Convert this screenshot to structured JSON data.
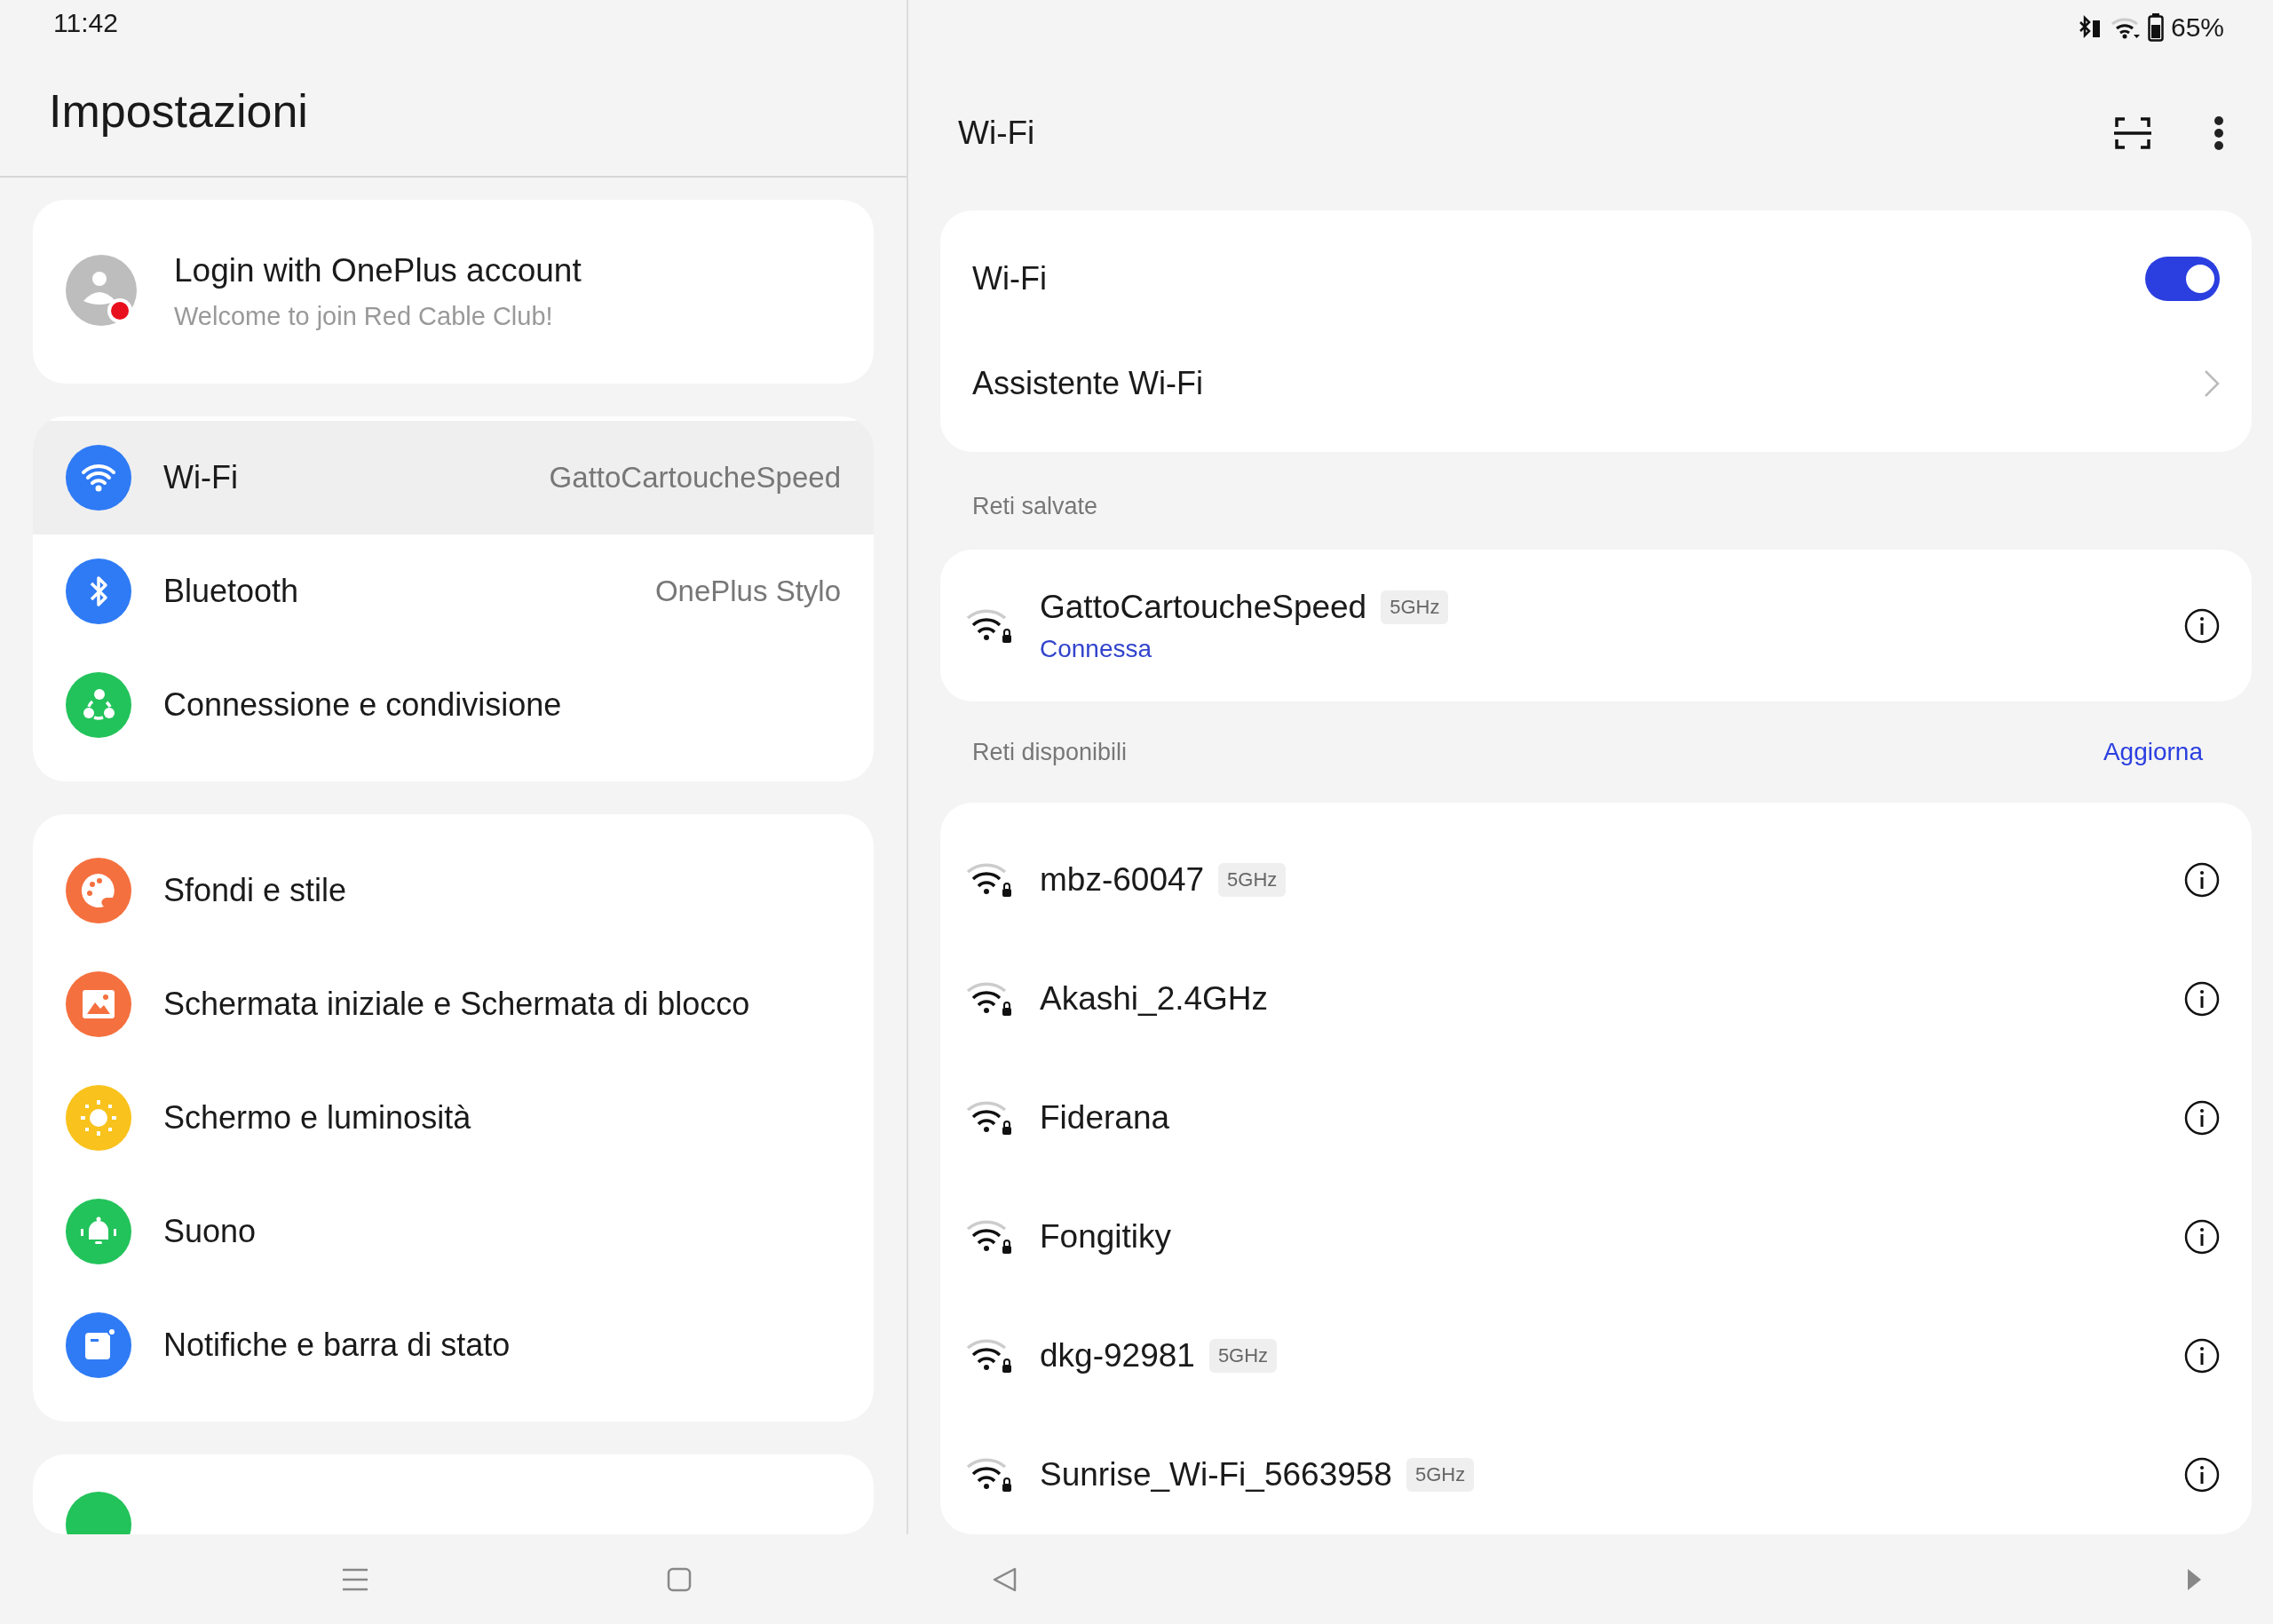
{
  "status_bar": {
    "time": "11:42",
    "battery": "65%"
  },
  "settings": {
    "title": "Impostazioni",
    "account": {
      "title": "Login with OnePlus account",
      "subtitle": "Welcome to join Red Cable Club!"
    },
    "groups": [
      {
        "items": [
          {
            "kind": "wifi",
            "label": "Wi-Fi",
            "value": "GattoCartoucheSpeed",
            "selected": true
          },
          {
            "kind": "bluetooth",
            "label": "Bluetooth",
            "value": "OnePlus Stylo",
            "selected": false
          },
          {
            "kind": "share",
            "label": "Connessione e condivisione",
            "selected": false
          }
        ]
      },
      {
        "items": [
          {
            "kind": "palette",
            "label": "Sfondi e stile",
            "selected": false
          },
          {
            "kind": "image",
            "label": "Schermata iniziale e Schermata di blocco",
            "selected": false
          },
          {
            "kind": "sun",
            "label": "Schermo e luminosità",
            "selected": false
          },
          {
            "kind": "bell",
            "label": "Suono",
            "selected": false
          },
          {
            "kind": "notification",
            "label": "Notifiche e barra di stato",
            "selected": false
          }
        ]
      }
    ]
  },
  "wifi": {
    "title": "Wi-Fi",
    "toggle": {
      "label": "Wi-Fi",
      "on": true
    },
    "assistant": {
      "label": "Assistente Wi-Fi"
    },
    "saved": {
      "heading": "Reti salvate",
      "networks": [
        {
          "name": "GattoCartoucheSpeed",
          "band": "5GHz",
          "status": "Connessa"
        }
      ]
    },
    "available": {
      "heading": "Reti disponibili",
      "action": "Aggiorna",
      "networks": [
        {
          "name": "mbz-60047",
          "band": "5GHz"
        },
        {
          "name": "Akashi_2.4GHz"
        },
        {
          "name": "Fiderana"
        },
        {
          "name": "Fongitiky"
        },
        {
          "name": "dkg-92981",
          "band": "5GHz"
        },
        {
          "name": "Sunrise_Wi-Fi_5663958",
          "band": "5GHz"
        }
      ]
    }
  }
}
